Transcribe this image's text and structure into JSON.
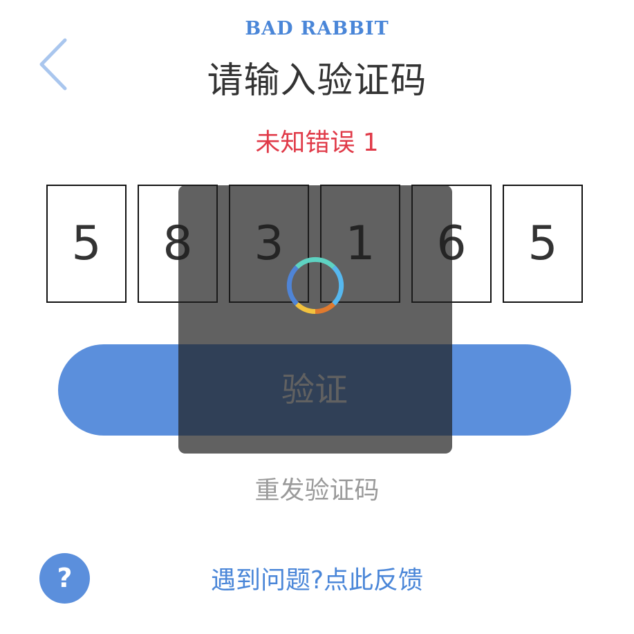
{
  "brand": "BAD RABBIT",
  "header": {
    "title": "请输入验证码"
  },
  "error_message": "未知错误 1",
  "code": {
    "digits": [
      "5",
      "8",
      "3",
      "1",
      "6",
      "5"
    ]
  },
  "actions": {
    "verify_label": "验证",
    "resend_label": "重发验证码",
    "help_label": "?",
    "feedback_label": "遇到问题?点此反馈"
  },
  "loading": {
    "visible": true
  },
  "colors": {
    "accent": "#5b8fdc",
    "brand": "#4a86d8",
    "error": "#e03a48",
    "title": "#333333",
    "muted": "#9a9a9a"
  },
  "icons": {
    "back": "chevron-left-icon",
    "help": "question-mark-icon",
    "loading": "loading-spinner-icon"
  }
}
